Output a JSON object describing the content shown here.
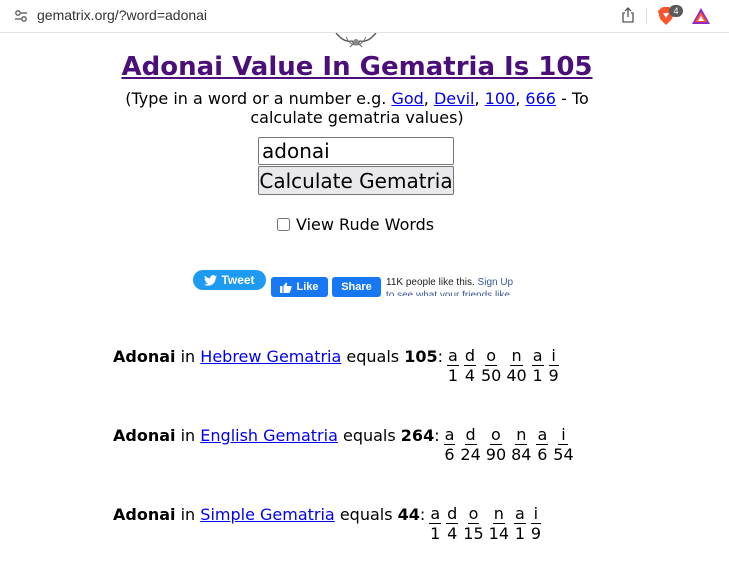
{
  "browser": {
    "url": "gematrix.org/?word=adonai",
    "shield_count": "4"
  },
  "page": {
    "title": "Adonai Value In Gematria Is 105",
    "intro": {
      "prefix": "(Type in a word or a number e.g.",
      "examples": [
        "God",
        "Devil",
        "100",
        "666"
      ],
      "sep1": ",",
      "sep2": ",",
      "sep3": ",",
      "suffix": "- To calculate gematria values)"
    },
    "search": {
      "value": "adonai",
      "button_label": "Calculate Gematria"
    },
    "rude_words_label": "View Rude Words",
    "rude_words_checked": false
  },
  "social": {
    "tweet_label": "Tweet",
    "like_label": "Like",
    "share_label": "Share",
    "fb_text": "11K people like this.",
    "fb_link": "Sign Up to see what your friends like."
  },
  "results": [
    {
      "word": "Adonai",
      "in_text": "in",
      "system": "Hebrew Gematria",
      "equals_text": "equals",
      "total": "105",
      "colon": ":",
      "letters": [
        "a",
        "d",
        "o",
        "n",
        "a",
        "i"
      ],
      "values": [
        "1",
        "4",
        "50",
        "40",
        "1",
        "9"
      ]
    },
    {
      "word": "Adonai",
      "in_text": "in",
      "system": "English Gematria",
      "equals_text": "equals",
      "total": "264",
      "colon": ":",
      "letters": [
        "a",
        "d",
        "o",
        "n",
        "a",
        "i"
      ],
      "values": [
        "6",
        "24",
        "90",
        "84",
        "6",
        "54"
      ]
    },
    {
      "word": "Adonai",
      "in_text": "in",
      "system": "Simple Gematria",
      "equals_text": "equals",
      "total": "44",
      "colon": ":",
      "letters": [
        "a",
        "d",
        "o",
        "n",
        "a",
        "i"
      ],
      "values": [
        "1",
        "4",
        "15",
        "14",
        "1",
        "9"
      ]
    }
  ],
  "colors": {
    "title": "#4b0f7a",
    "link": "#0000ee",
    "tweet": "#1d9bf0",
    "facebook": "#1877f2"
  }
}
